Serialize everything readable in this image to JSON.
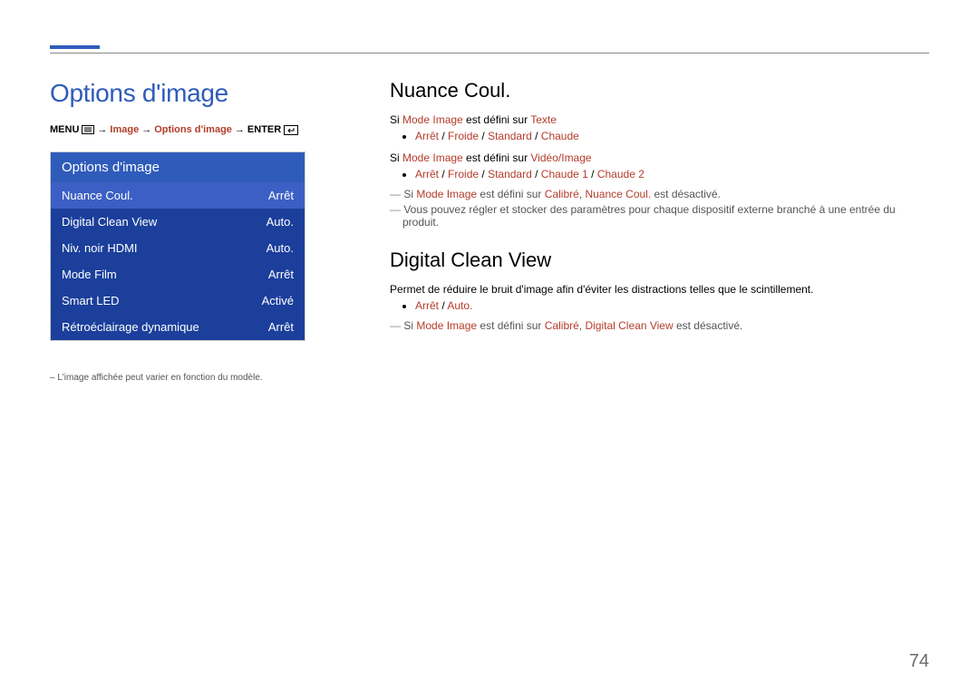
{
  "page_number": "74",
  "left": {
    "heading": "Options d'image",
    "breadcrumb": {
      "menu": "MENU",
      "seg_image": "Image",
      "seg_options": "Options d'image",
      "enter": "ENTER"
    },
    "menu": {
      "title": "Options d'image",
      "rows": [
        {
          "label": "Nuance Coul.",
          "value": "Arrêt",
          "selected": true
        },
        {
          "label": "Digital Clean View",
          "value": "Auto.",
          "selected": false
        },
        {
          "label": "Niv. noir HDMI",
          "value": "Auto.",
          "selected": false
        },
        {
          "label": "Mode Film",
          "value": "Arrêt",
          "selected": false
        },
        {
          "label": "Smart LED",
          "value": "Activé",
          "selected": false
        },
        {
          "label": "Rétroéclairage dynamique",
          "value": "Arrêt",
          "selected": false
        }
      ]
    },
    "footnote": "– L'image affichée peut varier en fonction du modèle."
  },
  "right": {
    "nuance": {
      "heading": "Nuance Coul.",
      "line1_pre": "Si ",
      "line1_hl": "Mode Image",
      "line1_mid": " est défini sur ",
      "line1_hl2": "Texte",
      "bullets1": [
        {
          "parts": [
            "Arrêt",
            "Froide",
            "Standard",
            "Chaude"
          ]
        }
      ],
      "line2_pre": "Si ",
      "line2_hl": "Mode Image",
      "line2_mid": " est défini sur ",
      "line2_hl2": "Vidéo/Image",
      "bullets2": [
        {
          "parts": [
            "Arrêt",
            "Froide",
            "Standard",
            "Chaude 1",
            "Chaude 2"
          ]
        }
      ],
      "note1_pre": "Si ",
      "note1_hl1": "Mode Image",
      "note1_mid": " est défini sur ",
      "note1_hl2": "Calibré",
      "note1_sep": ", ",
      "note1_hl3": "Nuance Coul.",
      "note1_post": " est désactivé.",
      "note2": "Vous pouvez régler et stocker des paramètres pour chaque dispositif externe branché à une entrée du produit."
    },
    "dcv": {
      "heading": "Digital Clean View",
      "desc": "Permet de réduire le bruit d'image afin d'éviter les distractions telles que le scintillement.",
      "bullet_parts": [
        "Arrêt",
        "Auto."
      ],
      "note_pre": "Si ",
      "note_hl1": "Mode Image",
      "note_mid": " est défini sur ",
      "note_hl2": "Calibré",
      "note_sep": ", ",
      "note_hl3": "Digital Clean View",
      "note_post": " est désactivé."
    }
  }
}
